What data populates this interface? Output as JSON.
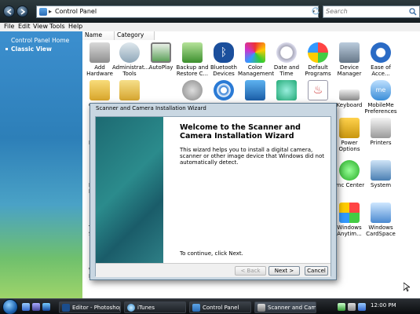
{
  "address": {
    "crumb": "Control Panel"
  },
  "search": {
    "placeholder": "Search"
  },
  "menu": [
    "File",
    "Edit",
    "View",
    "Tools",
    "Help"
  ],
  "nav": {
    "home": "Control Panel Home",
    "classic": "Classic View"
  },
  "columns": [
    "Name",
    "Category"
  ],
  "icons_row1": [
    [
      "Add",
      "Hardware"
    ],
    [
      "Administrat...",
      "Tools"
    ],
    [
      "AutoPlay",
      ""
    ],
    [
      "Backup and",
      "Restore C..."
    ],
    [
      "Bluetooth",
      "Devices"
    ],
    [
      "Color",
      "Management"
    ],
    [
      "Date and",
      "Time"
    ],
    [
      "Default",
      "Programs"
    ],
    [
      "Device",
      "Manager"
    ],
    [
      "Ease of",
      "Acce..."
    ]
  ],
  "icons_right": [
    {
      "l1": "Keyboard",
      "l2": ""
    },
    {
      "l1": "MobileMe",
      "l2": "Preferences"
    },
    {
      "l1": "Power",
      "l2": "Options"
    },
    {
      "l1": "Printers",
      "l2": ""
    },
    {
      "l1": "ync Center",
      "l2": ""
    },
    {
      "l1": "System",
      "l2": ""
    },
    {
      "l1": "Windows",
      "l2": "Anytim..."
    },
    {
      "l1": "Windows",
      "l2": "CardSpace"
    }
  ],
  "icons_left_partial": [
    "O",
    "N",
    "P",
    "Rep",
    "Ta",
    "Se",
    "Wi",
    "De"
  ],
  "wizard": {
    "title": "Scanner and Camera Installation Wizard",
    "heading": "Welcome to the Scanner and Camera Installation Wizard",
    "body": "This wizard helps you to install a digital camera, scanner or other image device that Windows did not automatically detect.",
    "continue": "To continue, click Next.",
    "back": "< Back",
    "next": "Next >",
    "cancel": "Cancel"
  },
  "taskbar": {
    "tasks": [
      "Editor - Photoshop ...",
      "iTunes",
      "Control Panel",
      "Scanner and Camer..."
    ],
    "clock": "12:00 PM"
  },
  "colors": {
    "accent": "#2d7fb8",
    "taskbar": "#1c2025",
    "wizard_side": "#2b8b8c"
  }
}
